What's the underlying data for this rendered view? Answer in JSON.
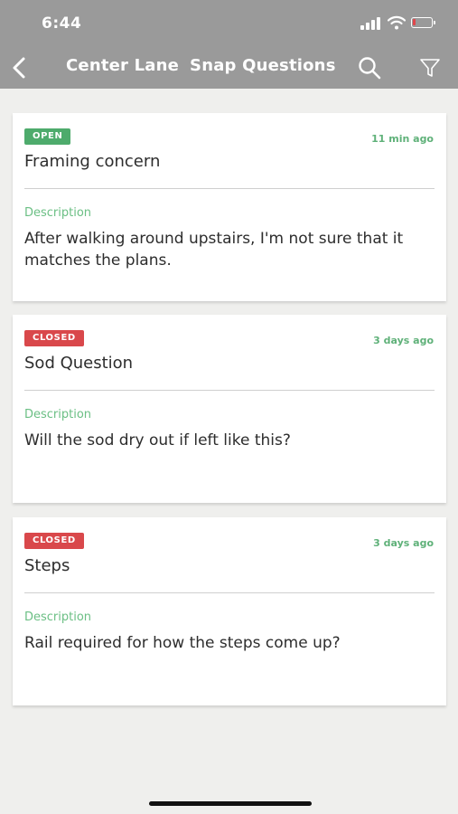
{
  "status_bar": {
    "time": "6:44"
  },
  "nav": {
    "title_parts": [
      "Center Lane",
      "Snap Questions"
    ]
  },
  "colors": {
    "open": "#4eab6c",
    "closed": "#d9484b",
    "accent_green": "#5fb179"
  },
  "questions": [
    {
      "status": "OPEN",
      "time_ago": "11 min ago",
      "title": "Framing concern",
      "description_label": "Description",
      "description": "After walking around upstairs, I'm not sure that it matches the plans."
    },
    {
      "status": "CLOSED",
      "time_ago": "3 days ago",
      "title": "Sod Question",
      "description_label": "Description",
      "description": "Will the sod dry out if left like this?"
    },
    {
      "status": "CLOSED",
      "time_ago": "3 days ago",
      "title": "Steps",
      "description_label": "Description",
      "description": "Rail required for how the steps come up?"
    }
  ]
}
